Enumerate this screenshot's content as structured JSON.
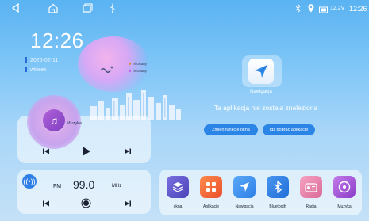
{
  "status_bar": {
    "voltage": "12.2V",
    "time": "12:26",
    "icons": [
      "back-icon",
      "home-icon",
      "recents-icon",
      "usb-icon",
      "bluetooth-icon",
      "location-icon",
      "battery-icon"
    ]
  },
  "clock": {
    "time": "12:26",
    "date": "2025-02-11",
    "weekday": "wtorek"
  },
  "weather": {
    "icon": "weather-wind-icon",
    "legend": [
      "nieznany",
      "nieznany"
    ],
    "legend_colors": [
      "#e38a2b",
      "#c45de0"
    ]
  },
  "music": {
    "label": "Muzyka",
    "controls": [
      "previous-icon",
      "play-icon",
      "next-icon"
    ]
  },
  "radio": {
    "band": "FM",
    "frequency": "99.0",
    "unit": "MHz",
    "controls": [
      "previous-icon",
      "record-icon",
      "next-icon"
    ]
  },
  "navigation": {
    "title": "Nawigacja",
    "message": "Ta aplikacja nie została znaleziona",
    "change_button": "Zmień funkcję okna",
    "download_button": "Idź pobrać aplikację"
  },
  "dock": {
    "apps": [
      {
        "label": "okna",
        "icon": "layers-icon",
        "color": "#5b55c8"
      },
      {
        "label": "Aplikacje",
        "icon": "apps-grid-icon",
        "color": "#f26a3a"
      },
      {
        "label": "Nawigacja",
        "icon": "navigation-icon",
        "color": "#3a8ef0"
      },
      {
        "label": "Bluetooth",
        "icon": "bluetooth-icon",
        "color": "#2f7fe8"
      },
      {
        "label": "Radia",
        "icon": "radio-icon",
        "color": "#e87fa8"
      },
      {
        "label": "Muzyka",
        "icon": "music-disc-icon",
        "color": "#a24fd2"
      }
    ]
  }
}
